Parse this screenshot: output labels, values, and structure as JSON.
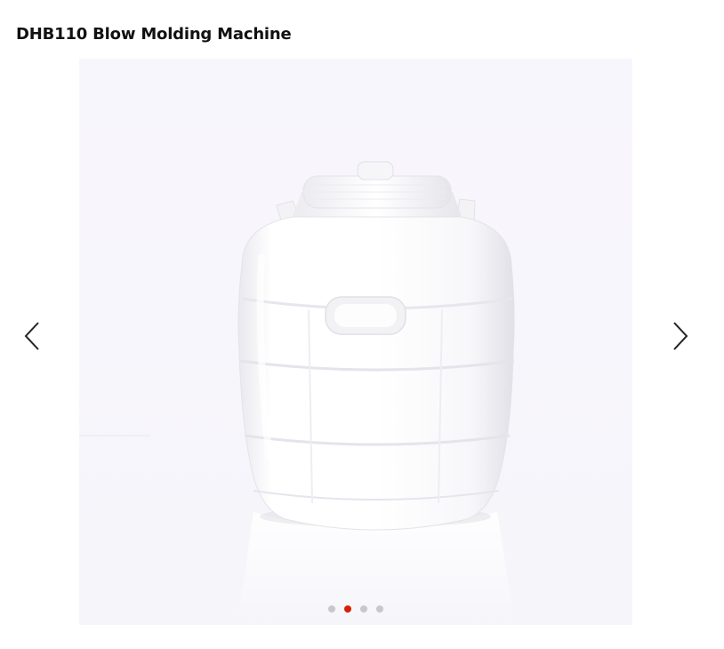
{
  "page": {
    "title": "DHB110 Blow Molding Machine"
  },
  "carousel": {
    "image": {
      "subject": "white plastic barrel container with screw lid and side handles",
      "background_color": "#f7f5fc",
      "product_color": "#ffffff"
    },
    "prev_icon": "chevron-left-icon",
    "next_icon": "chevron-right-icon",
    "slide_count": 4,
    "active_index": 1,
    "colors": {
      "dot_active": "#d81e06",
      "dot_inactive": "#c8c8c8",
      "arrow": "#222222"
    }
  }
}
